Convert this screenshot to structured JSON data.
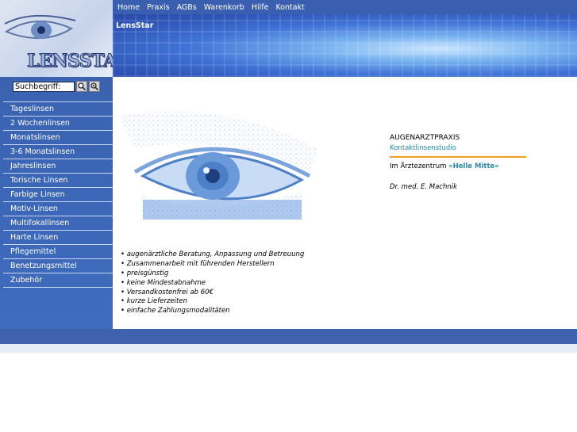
{
  "logo": {
    "text": "LENSSTAR"
  },
  "nav": {
    "items": [
      "Home",
      "Praxis",
      "AGBs",
      "Warenkorb",
      "Hilfe",
      "Kontakt"
    ]
  },
  "banner": {
    "title": "LensStar"
  },
  "search": {
    "value": "Suchbegriff:"
  },
  "sidebar": {
    "categories": [
      "Tageslinsen",
      "2 Wochenlinsen",
      "Monatslinsen",
      "3-6 Monatslinsen",
      "Jahreslinsen",
      "Torische Linsen",
      "Farbige Linsen",
      "Motiv-Linsen",
      "Multifokallinsen",
      "Harte Linsen",
      "Pflegemittel",
      "Benetzungsmittel",
      "Zubehör"
    ]
  },
  "practice": {
    "heading": "AUGENARZTPRAXIS",
    "subheading": "Kontaktlinsenstudio",
    "center_prefix": "Im Ärztezentrum ",
    "center_name": "»Helle Mitte«",
    "doctor": "Dr. med. E. Machnik"
  },
  "features": [
    "• augenärztliche Beratung, Anpassung und Betreuung",
    "• Zusammenarbeit mit führenden Herstellern",
    "• preisgünstig",
    "• keine Mindestabnahme",
    "• Versandkostenfrei ab 60€",
    "• kurze Lieferzeiten",
    "• einfache Zahlungsmodalitäten"
  ],
  "colors": {
    "nav_bg": "#3b5fb0",
    "sidebar_bg": "#3f6cbf",
    "accent_teal": "#2a8aa8",
    "rule_orange": "#f0a020"
  }
}
